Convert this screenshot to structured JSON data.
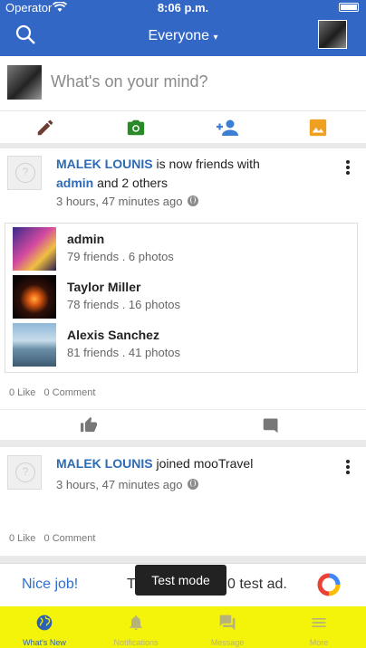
{
  "status_bar": {
    "carrier": "Operator",
    "time": "8:06 p.m."
  },
  "header": {
    "feed_filter": "Everyone"
  },
  "composer": {
    "placeholder": "What's on your mind?"
  },
  "posts": [
    {
      "actor": "MALEK LOUNIS",
      "action": "is now friends with",
      "target": "admin",
      "and_others": "and 2 others",
      "time": "3 hours, 47 minutes ago",
      "friends": [
        {
          "name": "admin",
          "stats": "79 friends . 6 photos"
        },
        {
          "name": "Taylor Miller",
          "stats": "78 friends . 16 photos"
        },
        {
          "name": "Alexis Sanchez",
          "stats": "81 friends . 41 photos"
        }
      ],
      "likes": "0 Like",
      "comments": "0 Comment"
    },
    {
      "actor": "MALEK LOUNIS",
      "action": "joined mooTravel",
      "time": "3 hours, 47 minutes ago",
      "likes": "0 Like",
      "comments": "0 Comment"
    }
  ],
  "ad": {
    "left_text": "Nice job!",
    "mid_text": "T",
    "right_text": "0 test ad.",
    "toast": "Test mode"
  },
  "tabs": [
    {
      "label": "What's New",
      "active": true
    },
    {
      "label": "Notifications"
    },
    {
      "label": "Message"
    },
    {
      "label": "More"
    }
  ],
  "colors": {
    "header_blue": "#3367c6",
    "tabbar_yellow": "#f4f30a",
    "link_blue": "#2e6bb5"
  }
}
